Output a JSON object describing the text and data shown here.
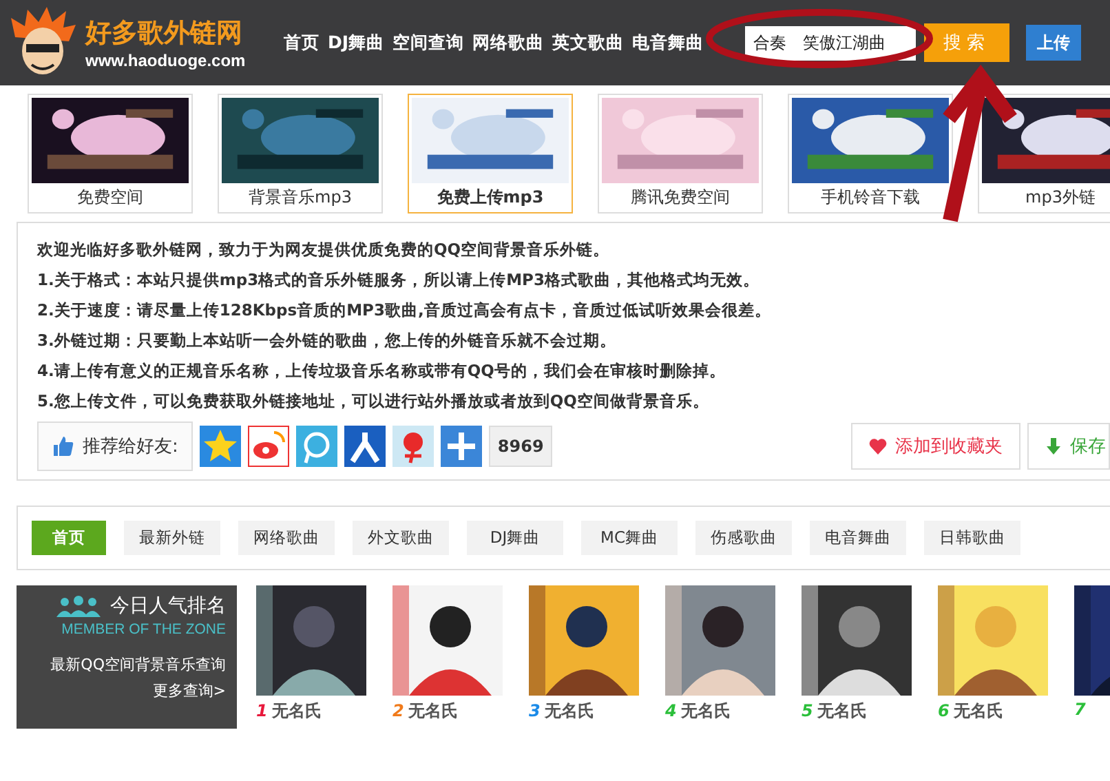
{
  "header": {
    "logo_title": "好多歌外链网",
    "logo_url": "www.haoduoge.com",
    "nav": [
      "首页",
      "DJ舞曲",
      "空间查询",
      "网络歌曲",
      "英文歌曲",
      "电音舞曲"
    ],
    "search": {
      "value": "合奏　笑傲江湖曲"
    },
    "search_button": "搜 索",
    "upload_button": "上传"
  },
  "features": [
    {
      "label": "免费空间",
      "selected": false
    },
    {
      "label": "背景音乐mp3",
      "selected": false
    },
    {
      "label": "免费上传mp3",
      "selected": true
    },
    {
      "label": "腾讯免费空间",
      "selected": false
    },
    {
      "label": "手机铃音下载",
      "selected": false
    },
    {
      "label": "mp3外链",
      "selected": false
    }
  ],
  "intro": [
    "欢迎光临好多歌外链网，致力于为网友提供优质免费的QQ空间背景音乐外链。",
    "1.关于格式：本站只提供mp3格式的音乐外链服务，所以请上传MP3格式歌曲，其他格式均无效。",
    "2.关于速度：请尽量上传128Kbps音质的MP3歌曲,音质过高会有点卡，音质过低试听效果会很差。",
    "3.外链过期：只要勤上本站听一会外链的歌曲，您上传的外链音乐就不会过期。",
    "4.请上传有意义的正规音乐名称，上传垃圾音乐名称或带有QQ号的，我们会在审核时删除掉。",
    "5.您上传文件，可以免费获取外链接地址，可以进行站外播放或者放到QQ空间做背景音乐。"
  ],
  "share": {
    "label": "推荐给好友:",
    "count": "8969"
  },
  "actions": [
    "添加到收藏夹",
    "保存"
  ],
  "categories": [
    {
      "label": "首页",
      "selected": true
    },
    {
      "label": "最新外链",
      "selected": false
    },
    {
      "label": "网络歌曲",
      "selected": false
    },
    {
      "label": "外文歌曲",
      "selected": false
    },
    {
      "label": "DJ舞曲",
      "selected": false
    },
    {
      "label": "MC舞曲",
      "selected": false
    },
    {
      "label": "伤感歌曲",
      "selected": false
    },
    {
      "label": "电音舞曲",
      "selected": false
    },
    {
      "label": "日韩歌曲",
      "selected": false
    }
  ],
  "ranking": {
    "title": "今日人气排名",
    "subtitle": "MEMBER OF THE ZONE",
    "text": "最新QQ空间背景音乐查询",
    "more": "更多查询>"
  },
  "members": [
    {
      "rank": "1",
      "name": "无名氏",
      "color": "#e8193c"
    },
    {
      "rank": "2",
      "name": "无名氏",
      "color": "#f07a1a"
    },
    {
      "rank": "3",
      "name": "无名氏",
      "color": "#1a8ae8"
    },
    {
      "rank": "4",
      "name": "无名氏",
      "color": "#2bbf3a"
    },
    {
      "rank": "5",
      "name": "无名氏",
      "color": "#2bbf3a"
    },
    {
      "rank": "6",
      "name": "无名氏",
      "color": "#2bbf3a"
    },
    {
      "rank": "7",
      "color": "#2bbf3a"
    }
  ]
}
